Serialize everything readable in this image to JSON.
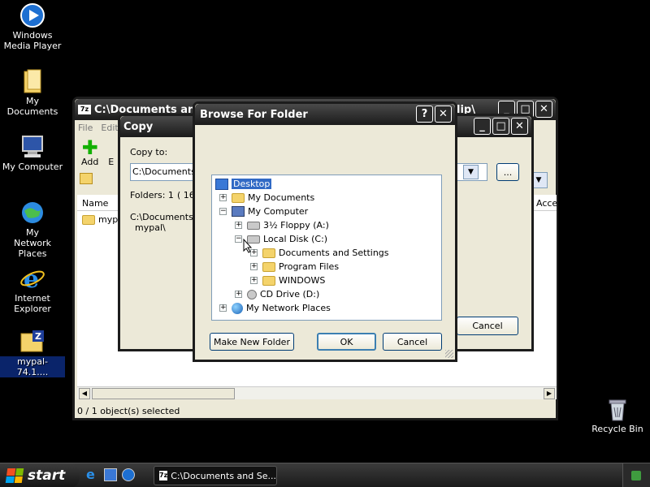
{
  "desktop": {
    "icons": [
      {
        "label": "Windows Media Player"
      },
      {
        "label": "My Documents"
      },
      {
        "label": "My Computer"
      },
      {
        "label": "My Network Places"
      },
      {
        "label": "Internet Explorer"
      },
      {
        "label": "mypal-74.1...."
      },
      {
        "label": "Recycle Bin"
      }
    ]
  },
  "bg_window": {
    "title": "C:\\Documents and Se",
    "title_tail": "lip\\",
    "menu": [
      "File",
      "Edit"
    ],
    "toolbar": {
      "add_label": "Add",
      "extract_label": "E"
    },
    "column_name": "Name",
    "column_accessed": "Acce",
    "file_item": "mypal",
    "status": "0 / 1 object(s) selected"
  },
  "copy_dialog": {
    "title": "Copy",
    "copy_to_label": "Copy to:",
    "path_value": "C:\\Documents a",
    "browse_button": "...",
    "folders_info": "Folders: 1",
    "folders_extra": "( 16",
    "path_line1": "C:\\Documents a",
    "path_line2": "mypal\\",
    "cancel_label": "Cancel"
  },
  "browse_dialog": {
    "title": "Browse For Folder",
    "tree": {
      "desktop": "Desktop",
      "my_documents": "My Documents",
      "my_computer": "My Computer",
      "floppy": "3½ Floppy (A:)",
      "local_disk": "Local Disk (C:)",
      "docs_settings": "Documents and Settings",
      "program_files": "Program Files",
      "windows": "WINDOWS",
      "cd_drive": "CD Drive (D:)",
      "network": "My Network Places"
    },
    "make_new_folder_label": "Make New Folder",
    "ok_label": "OK",
    "cancel_label": "Cancel"
  },
  "taskbar": {
    "start_label": "start",
    "task_label": "C:\\Documents and Se..."
  },
  "colors": {
    "selection": "#316ac5",
    "title_dark": "#1a1a1a",
    "dialog_face": "#ece9d8"
  }
}
